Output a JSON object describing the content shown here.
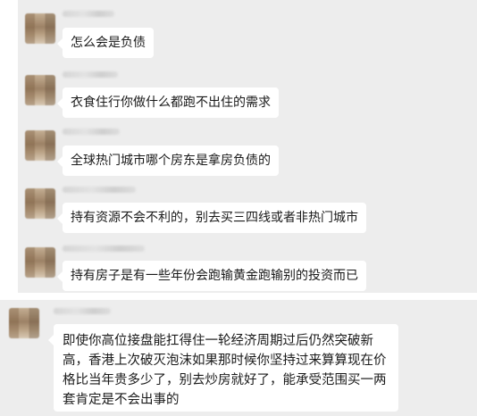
{
  "messages": [
    {
      "text": "怎么会是负债"
    },
    {
      "text": "衣食住行你做什么都跑不出住的需求"
    },
    {
      "text": "全球热门城市哪个房东是拿房负债的"
    },
    {
      "text": "持有资源不会不利的，别去买三四线或者非热门城市"
    },
    {
      "text": "持有房子是有一些年份会跑输黄金跑输别的投资而已"
    },
    {
      "text": "即使你高位接盘能扛得住一轮经济周期过后仍然突破新高，香港上次破灭泡沫如果那时候你坚持过来算算现在价格比当年贵多少了，别去炒房就好了，能承受范围买一两套肯定是不会出事的"
    }
  ]
}
